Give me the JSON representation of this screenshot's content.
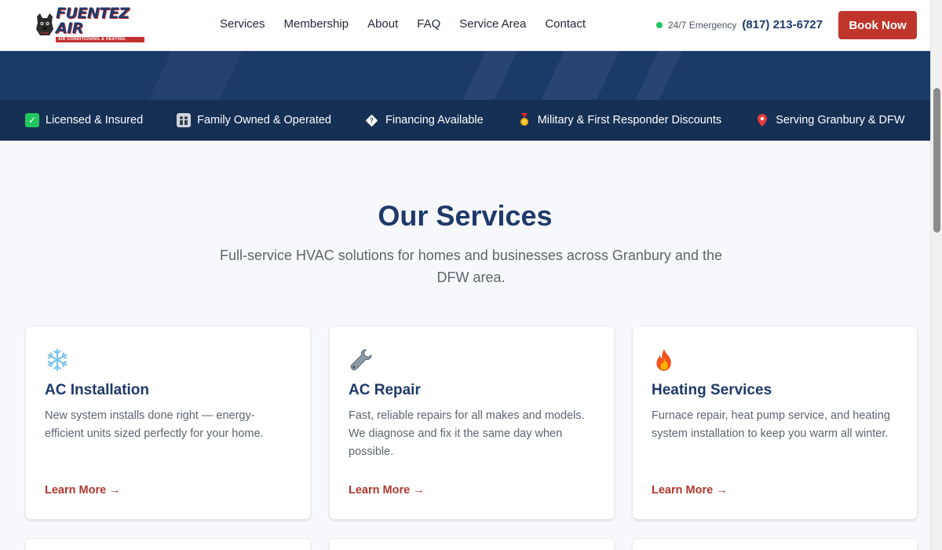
{
  "header": {
    "logo_text": "FUENTEZ AIR",
    "logo_sub": "AIR CONDITIONING & HEATING",
    "nav": [
      "Services",
      "Membership",
      "About",
      "FAQ",
      "Service Area",
      "Contact"
    ],
    "emergency_label": "24/7 Emergency",
    "phone": "(817) 213-6727",
    "book_label": "Book Now"
  },
  "trust_bar": [
    {
      "icon": "check-icon",
      "label": "Licensed & Insured"
    },
    {
      "icon": "family-icon",
      "label": "Family Owned & Operated"
    },
    {
      "icon": "financing-icon",
      "label": "Financing Available"
    },
    {
      "icon": "medal-icon",
      "label": "Military & First Responder Discounts"
    },
    {
      "icon": "location-pin-icon",
      "label": "Serving Granbury & DFW"
    }
  ],
  "services": {
    "title": "Our Services",
    "subtitle": "Full-service HVAC solutions for homes and businesses across Granbury and the DFW area.",
    "cards": [
      {
        "icon": "snowflake-icon",
        "title": "AC Installation",
        "text": "New system installs done right — energy-efficient units sized perfectly for your home.",
        "link": "Learn More →"
      },
      {
        "icon": "wrench-icon",
        "title": "AC Repair",
        "text": "Fast, reliable repairs for all makes and models. We diagnose and fix it the same day when possible.",
        "link": "Learn More →"
      },
      {
        "icon": "fire-icon",
        "title": "Heating Services",
        "text": "Furnace repair, heat pump service, and heating system installation to keep you warm all winter.",
        "link": "Learn More →"
      }
    ]
  },
  "colors": {
    "brand_navy": "#1e3a6b",
    "accent_red": "#c0352b",
    "trust_bar_bg": "#162f55"
  }
}
